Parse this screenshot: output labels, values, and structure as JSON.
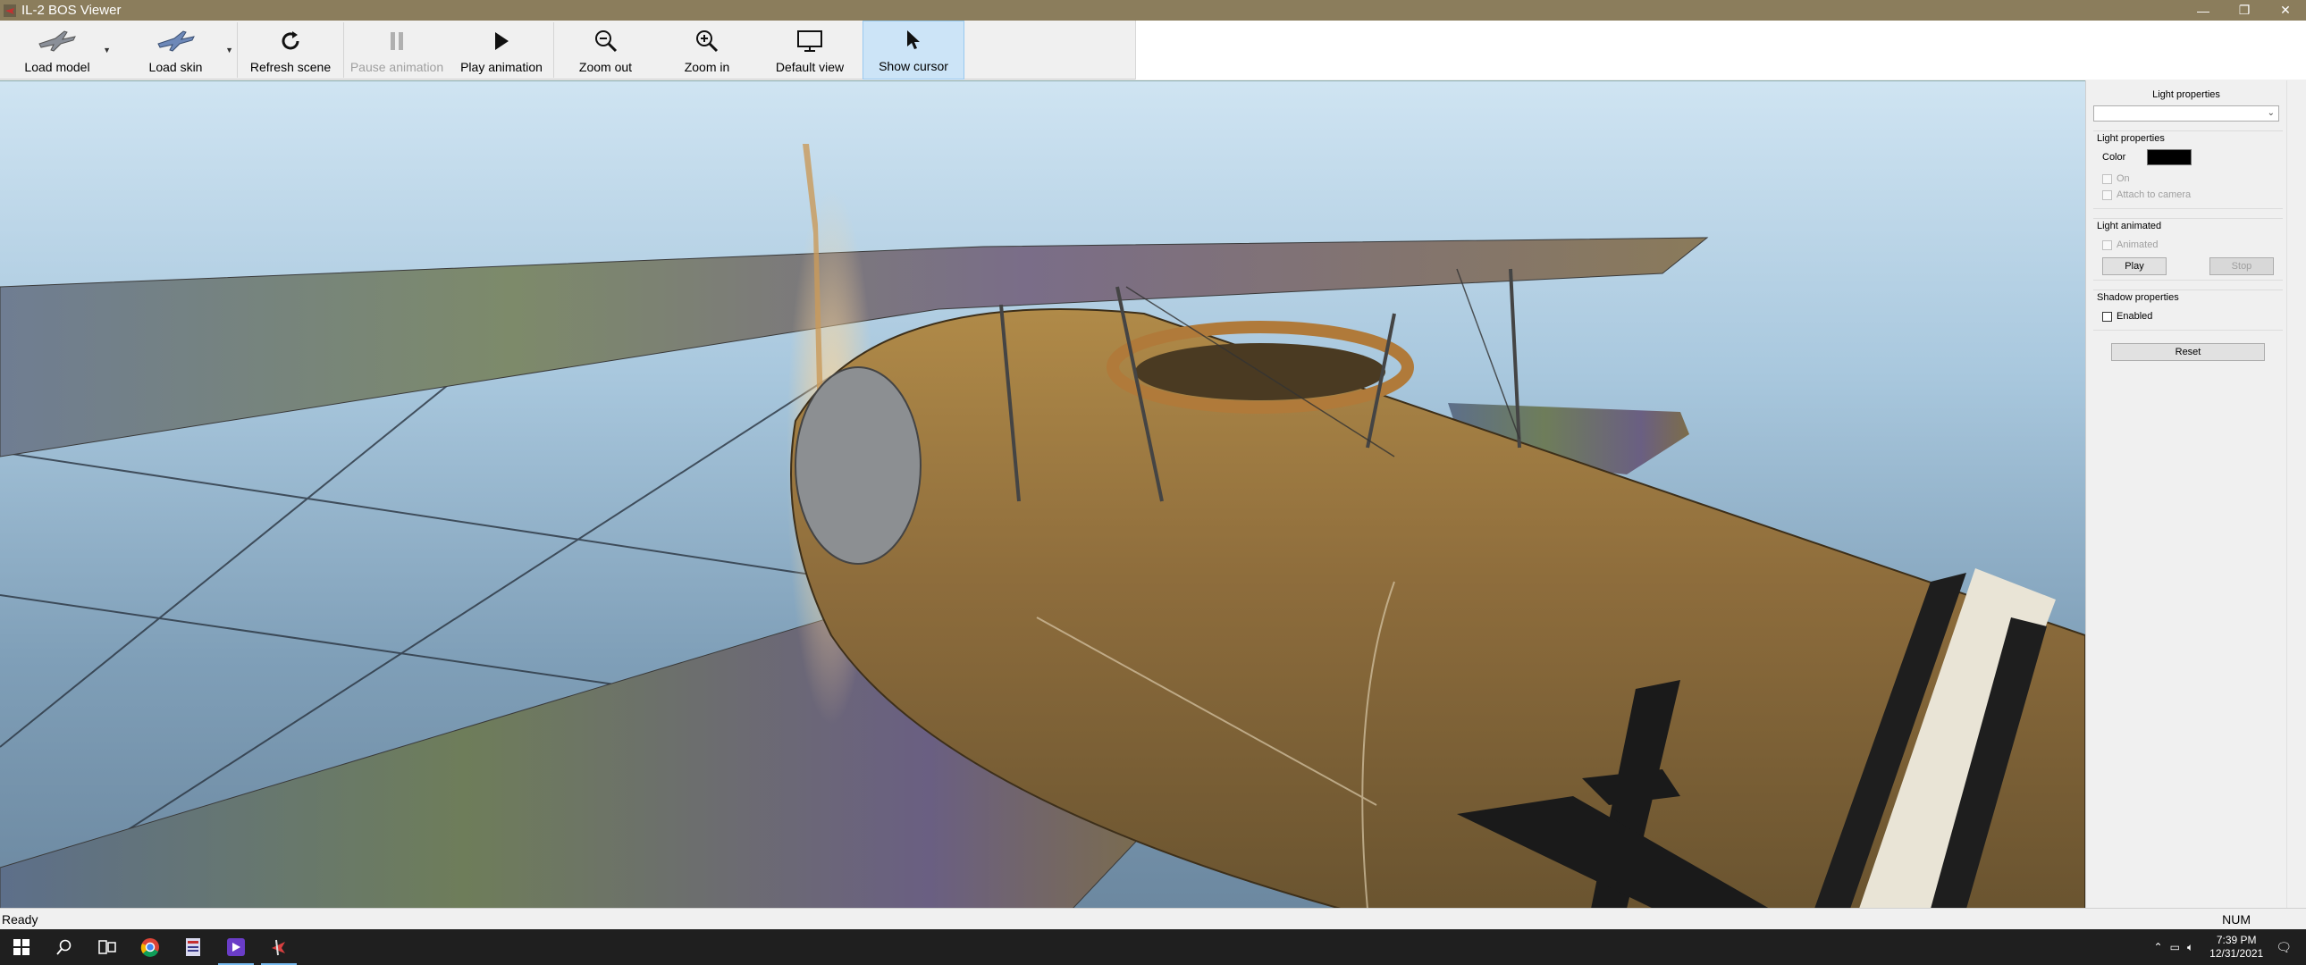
{
  "window": {
    "title": "IL-2 BOS Viewer",
    "controls": [
      "—",
      "❐",
      "✕"
    ]
  },
  "toolbar": {
    "load_model": "Load model",
    "load_skin": "Load skin",
    "refresh_scene": "Refresh scene",
    "pause_animation": "Pause animation",
    "play_animation": "Play animation",
    "zoom_out": "Zoom out",
    "zoom_in": "Zoom in",
    "default_view": "Default view",
    "show_cursor": "Show cursor"
  },
  "panel": {
    "header": "Light properties",
    "combo_value": "",
    "light_group": {
      "title": "Light properties",
      "color_label": "Color",
      "color_value": "#000000",
      "on_label": "On",
      "attach_label": "Attach to camera"
    },
    "anim_group": {
      "title": "Light animated",
      "animated_label": "Animated",
      "play_label": "Play",
      "stop_label": "Stop"
    },
    "shadow_group": {
      "title": "Shadow properties",
      "enabled_label": "Enabled"
    },
    "reset_label": "Reset"
  },
  "status": {
    "text": "Ready",
    "num": "NUM"
  },
  "taskbar": {
    "time": "7:39 PM",
    "date": "12/31/2021"
  },
  "colors": {
    "titlebar": "#8b7d5c",
    "active_tool": "#cce4f7",
    "taskbar": "#1f1f1f"
  }
}
